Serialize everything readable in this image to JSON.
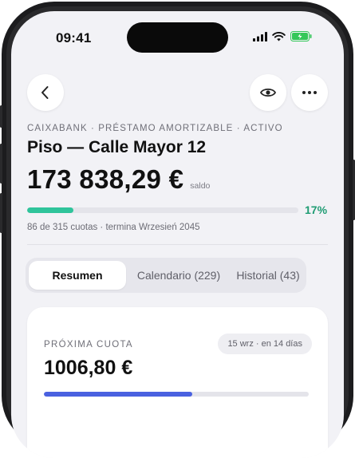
{
  "status_bar": {
    "time": "09:41"
  },
  "header": {
    "eyebrow": "CAIXABANK · PRÉSTAMO AMORTIZABLE · ACTIVO",
    "title": "Piso — Calle Mayor 12",
    "balance": "173 838,29 €",
    "balance_label": "saldo"
  },
  "progress": {
    "fraction": 0.17,
    "percent_label": "17%",
    "subinfo": "86 de 315 cuotas · termina Wrzesień 2045",
    "color": "#2fc49b"
  },
  "tabs": [
    {
      "label": "Resumen",
      "active": true
    },
    {
      "label": "Calendario (229)",
      "active": false
    },
    {
      "label": "Historial (43)",
      "active": false
    }
  ],
  "next_payment": {
    "label": "PRÓXIMA CUOTA",
    "badge": "15 wrz · en 14 días",
    "amount": "1006,80 €",
    "fraction": 0.56,
    "color": "#4a61e0"
  },
  "icons": {
    "back": "chevron-left-icon",
    "view": "eye-icon",
    "more": "more-horizontal-icon"
  }
}
